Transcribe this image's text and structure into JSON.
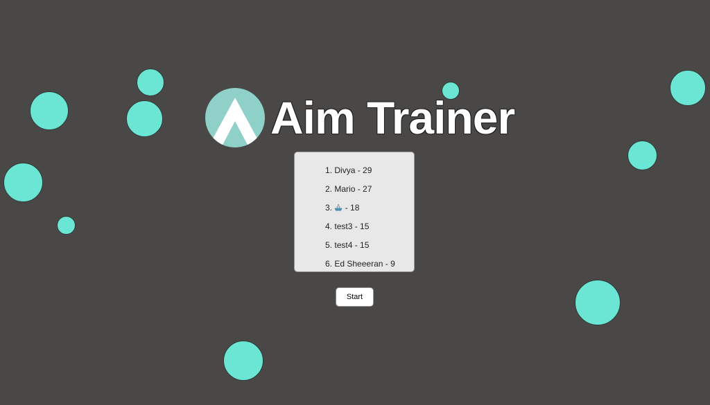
{
  "app": {
    "title": "Aim Trainer"
  },
  "colors": {
    "background": "#4a4846",
    "target": "#6ce6d4",
    "logo": "#8fd0c8"
  },
  "leaderboard": {
    "entries": [
      {
        "rank": "1.",
        "name": "Divya",
        "score": "29"
      },
      {
        "rank": "2.",
        "name": "Mario",
        "score": "27"
      },
      {
        "rank": "3.",
        "name": "",
        "score": "18",
        "icon": "boat-emoji"
      },
      {
        "rank": "4.",
        "name": "test3",
        "score": "15"
      },
      {
        "rank": "5.",
        "name": "test4",
        "score": "15"
      },
      {
        "rank": "6.",
        "name": "Ed Sheeeran",
        "score": "9"
      }
    ]
  },
  "controls": {
    "start_label": "Start"
  }
}
